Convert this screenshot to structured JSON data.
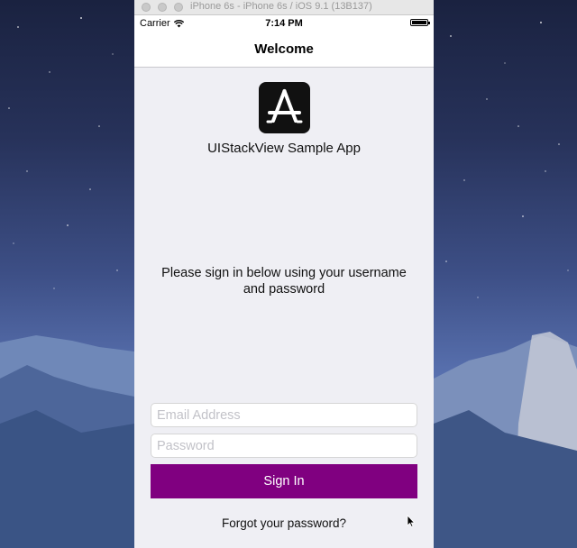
{
  "simulator": {
    "window_title": "iPhone 6s - iPhone 6s / iOS 9.1 (13B137)"
  },
  "status_bar": {
    "carrier": "Carrier",
    "time": "7:14 PM"
  },
  "nav_bar": {
    "title": "Welcome"
  },
  "header": {
    "app_name": "UIStackView Sample App",
    "app_icon": "app-store-icon"
  },
  "body": {
    "instructions": "Please sign in below using your username and password"
  },
  "form": {
    "email_placeholder": "Email Address",
    "password_placeholder": "Password",
    "sign_in_label": "Sign In",
    "forgot_label": "Forgot your password?"
  },
  "colors": {
    "sign_in_button": "#800080",
    "screen_background": "#efeff4"
  }
}
